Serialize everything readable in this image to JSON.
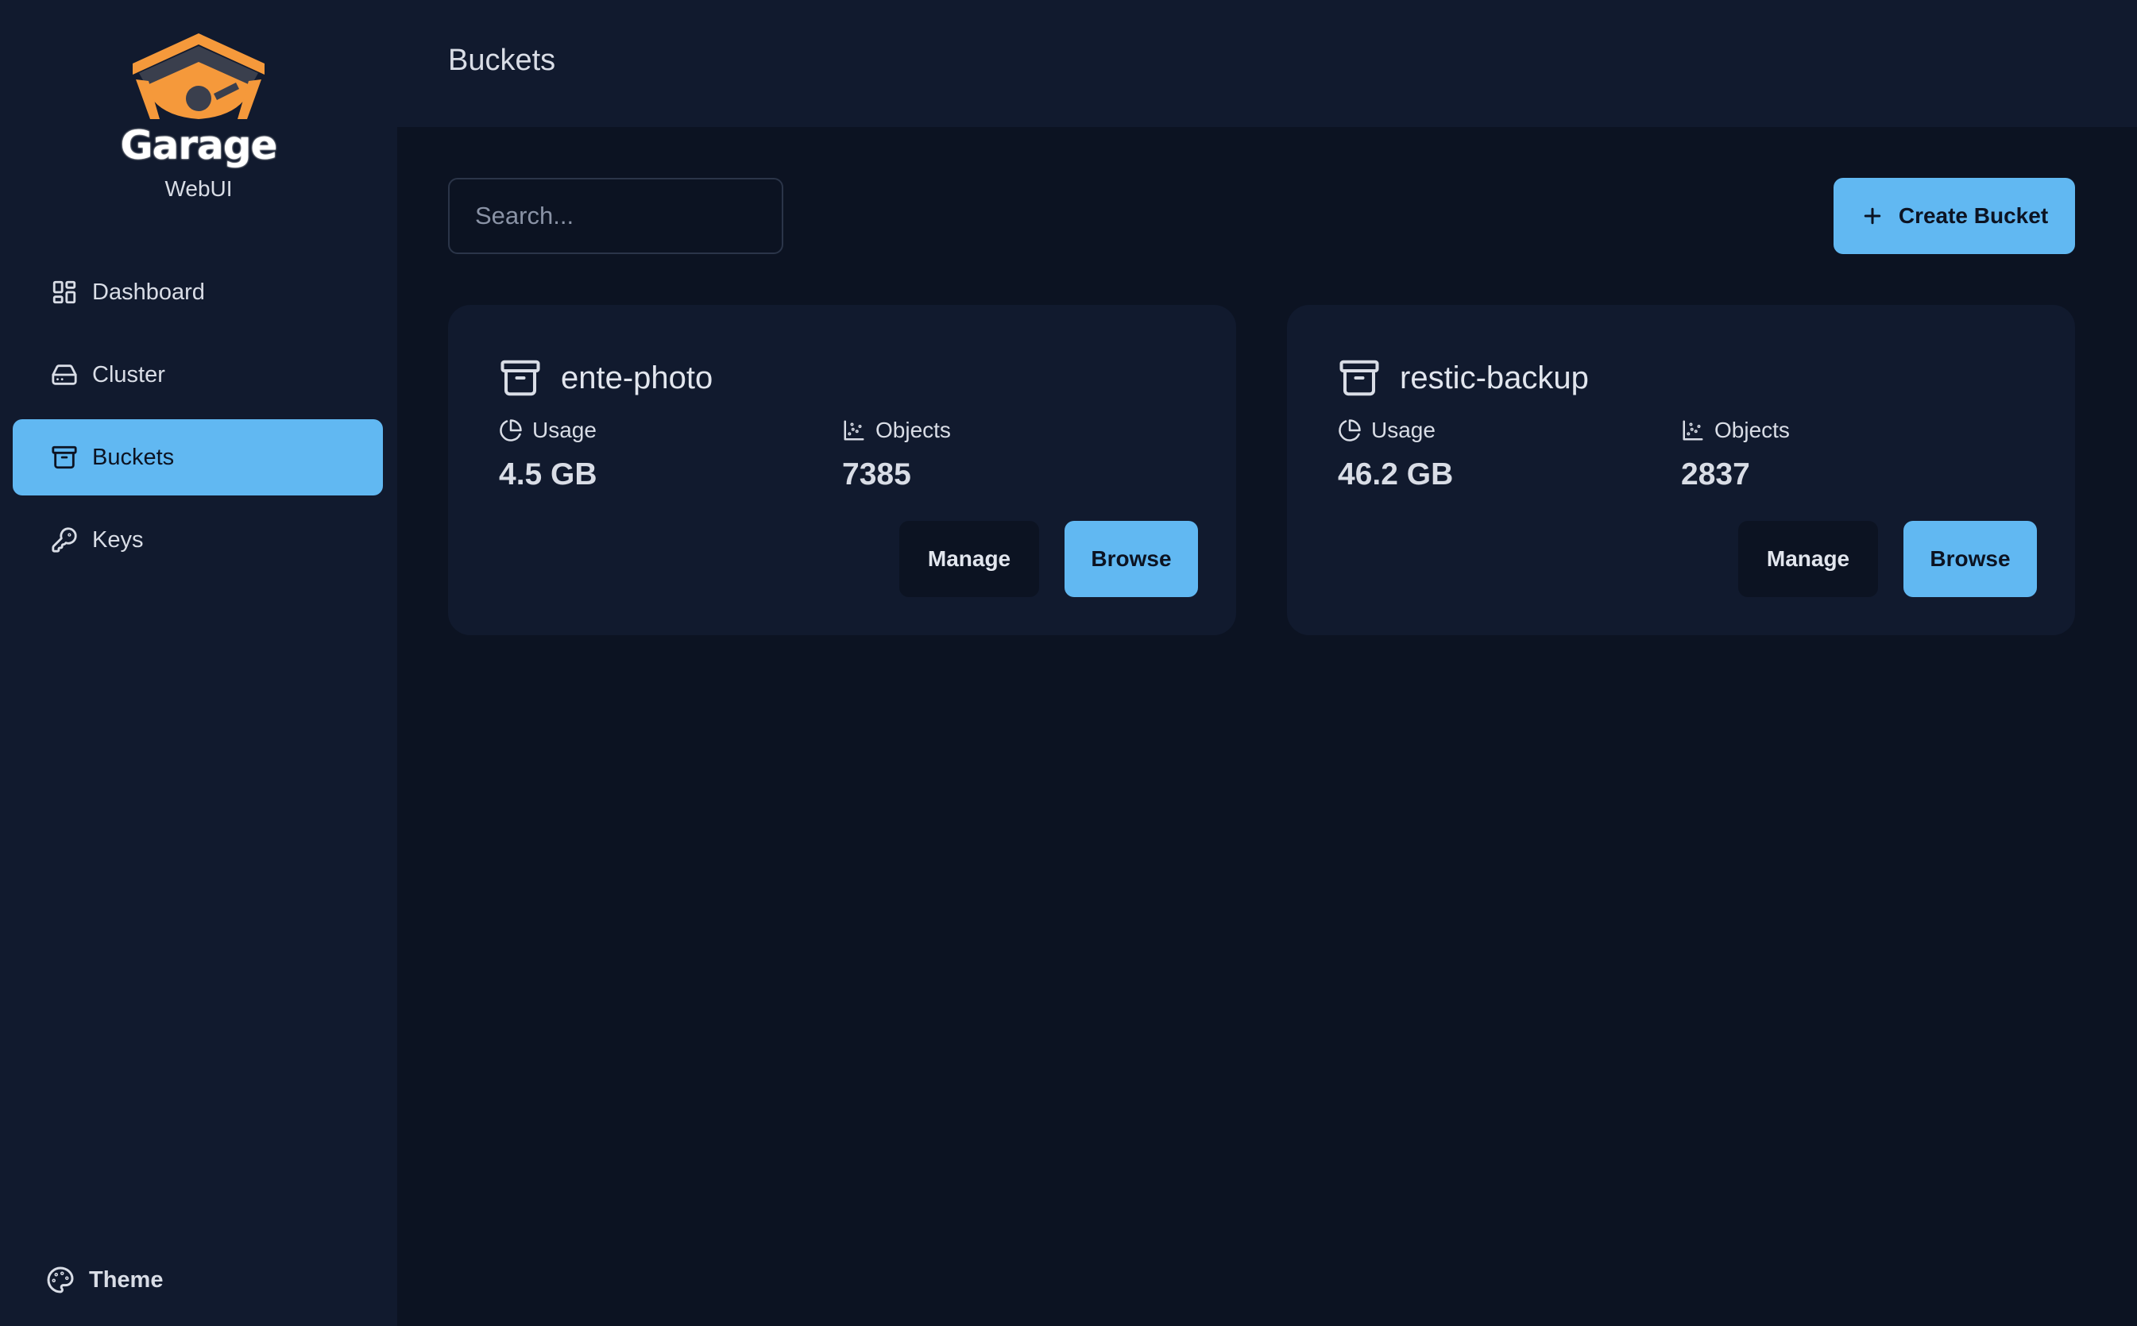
{
  "brand": {
    "name": "Garage",
    "subtitle": "WebUI"
  },
  "sidebar": {
    "items": [
      {
        "label": "Dashboard",
        "icon": "dashboard-icon",
        "active": false
      },
      {
        "label": "Cluster",
        "icon": "hard-drive-icon",
        "active": false
      },
      {
        "label": "Buckets",
        "icon": "archive-icon",
        "active": true
      },
      {
        "label": "Keys",
        "icon": "key-icon",
        "active": false
      }
    ],
    "theme_label": "Theme"
  },
  "header": {
    "title": "Buckets"
  },
  "toolbar": {
    "search_placeholder": "Search...",
    "create_label": "Create Bucket"
  },
  "buckets": [
    {
      "name": "ente-photo",
      "usage_label": "Usage",
      "usage": "4.5 GB",
      "objects_label": "Objects",
      "objects": "7385",
      "manage_label": "Manage",
      "browse_label": "Browse"
    },
    {
      "name": "restic-backup",
      "usage_label": "Usage",
      "usage": "46.2 GB",
      "objects_label": "Objects",
      "objects": "2837",
      "manage_label": "Manage",
      "browse_label": "Browse"
    }
  ],
  "colors": {
    "background": "#0c1322",
    "panel": "#111a2e",
    "accent": "#61b8f2",
    "logo": "#f5993b"
  }
}
